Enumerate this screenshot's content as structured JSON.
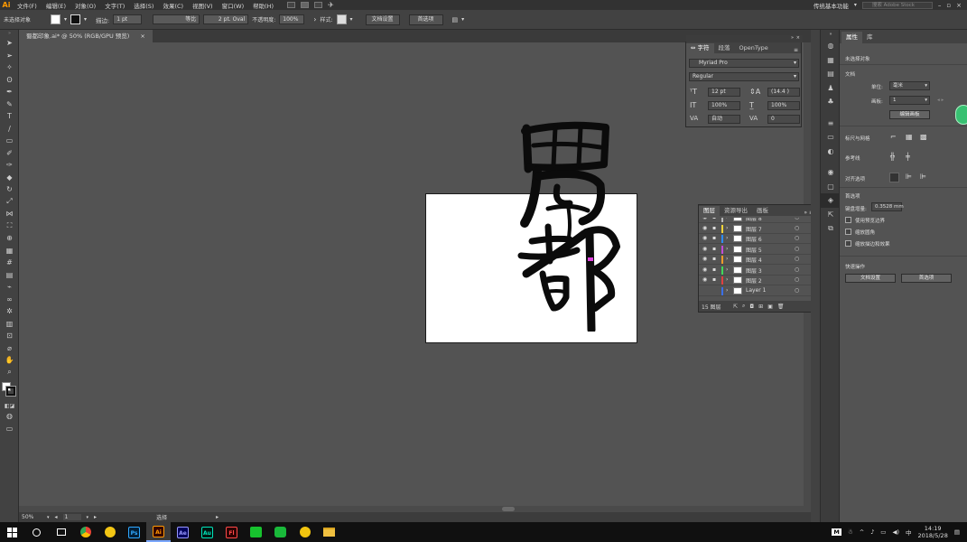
{
  "menubar": {
    "logo": "Ai",
    "items": [
      "文件(F)",
      "编辑(E)",
      "对象(O)",
      "文字(T)",
      "选择(S)",
      "效果(C)",
      "视图(V)",
      "窗口(W)",
      "帮助(H)"
    ],
    "workspace": "传统基本功能",
    "search_placeholder": "搜索 Adobe Stock"
  },
  "controlbar": {
    "selection": "未选择对象",
    "stroke_label": "描边:",
    "stroke_value": "1 pt",
    "stroke_profile": "等比",
    "brush": "2 pt. Oval",
    "opacity_label": "不透明度:",
    "opacity_value": "100%",
    "style_label": "样式:",
    "doc_setup": "文档设置",
    "preferences": "首选项"
  },
  "document_tab": {
    "title": "蜀都印象.ai* @ 50% (RGB/GPU 预览)",
    "close": "×"
  },
  "status": {
    "zoom": "50%",
    "page": "1",
    "mode": "选择"
  },
  "character_panel": {
    "tabs": [
      "字符",
      "段落",
      "OpenType"
    ],
    "font_family": "Myriad Pro",
    "font_style": "Regular",
    "font_size": "12 pt",
    "leading": "(14.4 )",
    "vscale": "100%",
    "hscale": "100%",
    "kerning": "自动",
    "tracking": "0"
  },
  "layers_panel": {
    "tabs": [
      "图层",
      "资源导出",
      "画板"
    ],
    "layers": [
      {
        "name": "图层 8",
        "color": "#b8b8b8"
      },
      {
        "name": "图层 7",
        "color": "#f2d43a"
      },
      {
        "name": "图层 6",
        "color": "#2d8cff"
      },
      {
        "name": "图层 5",
        "color": "#c24bd8"
      },
      {
        "name": "图层 4",
        "color": "#f39a2a"
      },
      {
        "name": "图层 3",
        "color": "#3fd85a"
      },
      {
        "name": "图层 2",
        "color": "#e04040"
      },
      {
        "name": "Layer 1",
        "color": "#3b6fe8"
      }
    ],
    "count": "15 图层"
  },
  "properties_panel": {
    "tabs": [
      "属性",
      "库"
    ],
    "no_selection": "未选择对象",
    "document": "文档",
    "units_label": "单位:",
    "units_value": "毫米",
    "artboard_label": "画板:",
    "artboard_value": "1",
    "edit_artboards": "编辑画板",
    "rulers_grids": "标尺与网格",
    "guides": "参考线",
    "align_to": "对齐选项",
    "preferences_section": "首选项",
    "keyboard_increment_label": "键盘增量:",
    "keyboard_increment_value": "0.3528 mm",
    "use_preview_bounds": "使用预览边界",
    "scale_corners": "缩放圆角",
    "scale_strokes": "缩放描边和效果",
    "quick_actions": "快速操作",
    "doc_setup_btn": "文档设置",
    "preferences_btn": "首选项"
  },
  "taskbar": {
    "time": "14:19",
    "date": "2018/5/28",
    "apps": [
      {
        "label": "Ps",
        "color": "#31a8ff",
        "bg": "#001e36"
      },
      {
        "label": "Ai",
        "color": "#ff9a00",
        "bg": "#330000"
      },
      {
        "label": "Ae",
        "color": "#9999ff",
        "bg": "#00005b"
      },
      {
        "label": "Au",
        "color": "#00e4bb",
        "bg": "#00150f"
      },
      {
        "label": "Fl",
        "color": "#ff4a4a",
        "bg": "#2b0000"
      }
    ]
  }
}
